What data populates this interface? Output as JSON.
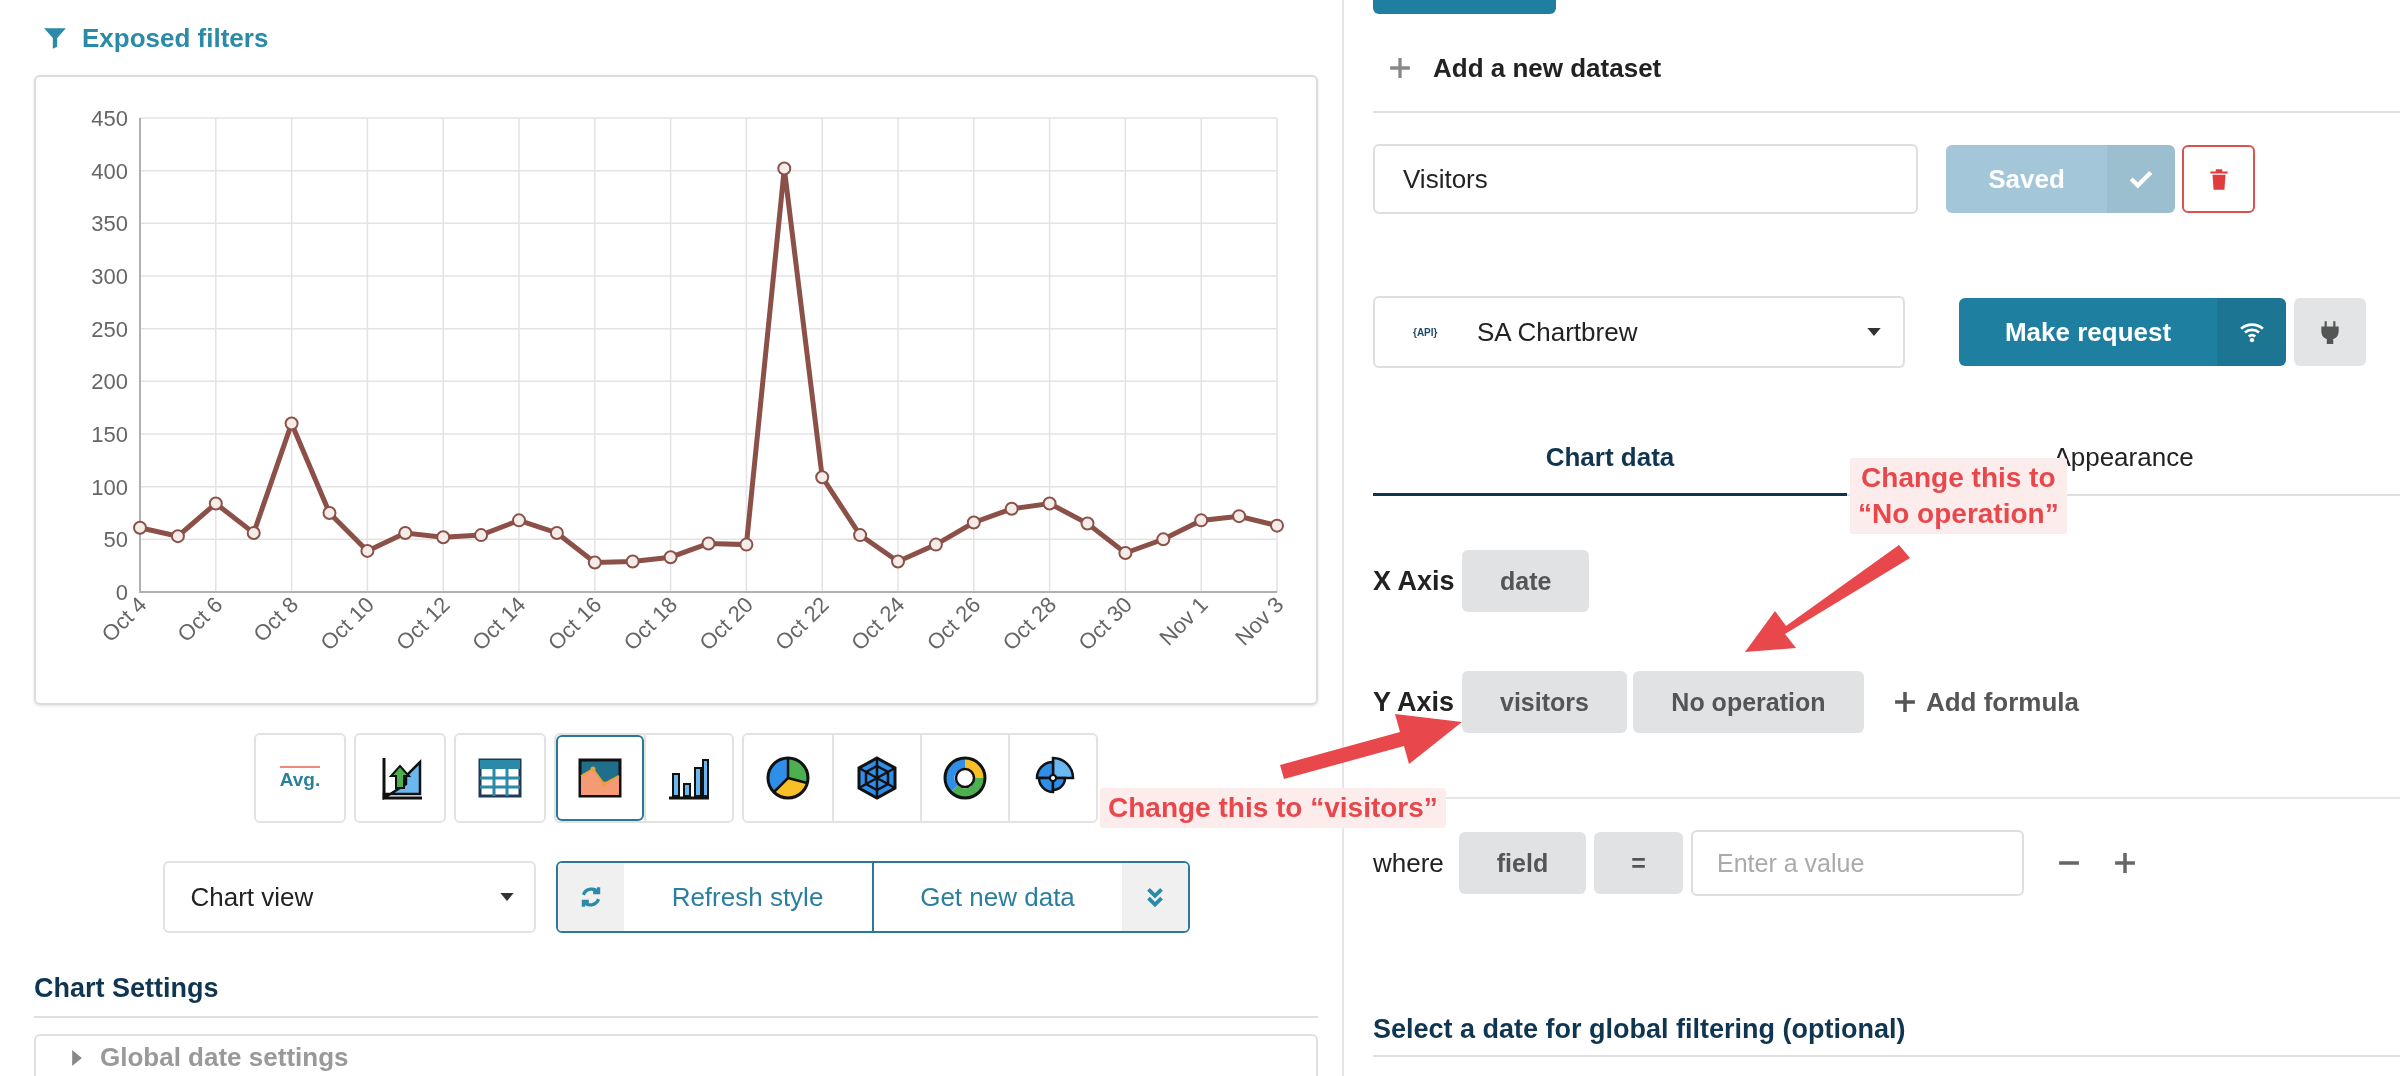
{
  "exposed_filters": {
    "label": "Exposed filters"
  },
  "chart": {
    "chart_data": {
      "type": "line",
      "categories": [
        "Oct 4",
        null,
        "Oct 6",
        null,
        "Oct 8",
        null,
        "Oct 10",
        null,
        "Oct 12",
        null,
        "Oct 14",
        null,
        "Oct 16",
        null,
        "Oct 18",
        null,
        "Oct 20",
        null,
        "Oct 22",
        null,
        "Oct 24",
        null,
        "Oct 26",
        null,
        "Oct 28",
        null,
        "Oct 30",
        null,
        "Nov 1",
        null,
        "Nov 3"
      ],
      "grid": true,
      "series": [
        {
          "color": "#8b5148",
          "marker": "circle",
          "values": [
            61,
            53,
            84,
            56,
            160,
            75,
            39,
            56,
            52,
            54,
            68,
            56,
            28,
            29,
            33,
            46,
            45,
            402,
            109,
            54,
            29,
            45,
            66,
            79,
            84,
            65,
            37,
            50,
            68,
            72,
            63
          ]
        }
      ],
      "ylim": [
        0,
        450
      ],
      "yticks": [
        0,
        50,
        100,
        150,
        200,
        250,
        300,
        350,
        400,
        450
      ]
    }
  },
  "chart_type_groups": [
    {
      "types": [
        {
          "kind": "kpi",
          "label": "Avg.",
          "selected": false
        }
      ]
    },
    {
      "types": [
        {
          "kind": "growth",
          "selected": false
        }
      ]
    },
    {
      "types": [
        {
          "kind": "table",
          "selected": false
        }
      ]
    },
    {
      "types": [
        {
          "kind": "area",
          "selected": true
        },
        {
          "kind": "bar",
          "selected": false
        }
      ]
    },
    {
      "types": [
        {
          "kind": "pie",
          "selected": false
        },
        {
          "kind": "radar",
          "selected": false
        },
        {
          "kind": "donut",
          "selected": false
        },
        {
          "kind": "polar",
          "selected": false
        }
      ]
    }
  ],
  "view_select": {
    "value": "Chart view"
  },
  "actions": {
    "refresh": "Refresh style",
    "get_data": "Get new data"
  },
  "chart_settings": {
    "title": "Chart Settings",
    "sections": [
      {
        "label": "Global date settings",
        "expanded": false
      }
    ]
  },
  "dataset": {
    "add_label": "Add a new dataset",
    "name": "Visitors",
    "save_label": "Saved",
    "saved": true,
    "source_badge": "{API}",
    "source": "SA Chartbrew",
    "request_label": "Make request"
  },
  "tabs": [
    {
      "label": "Chart data",
      "selected": true
    },
    {
      "label": "Appearance",
      "selected": false
    }
  ],
  "x_axis": {
    "label": "X Axis",
    "field": "date"
  },
  "y_axis": {
    "label": "Y Axis",
    "field": "visitors",
    "operation": "No operation",
    "add_formula": "Add formula"
  },
  "filter": {
    "label": "where",
    "field": "field",
    "operator": "=",
    "placeholder": "Enter a value"
  },
  "global_filter": {
    "title": "Select a date for global filtering (optional)"
  },
  "annotations": [
    {
      "lines": [
        "Change this to “visitors”"
      ]
    },
    {
      "lines": [
        "Change this to",
        "“No operation”"
      ]
    }
  ]
}
